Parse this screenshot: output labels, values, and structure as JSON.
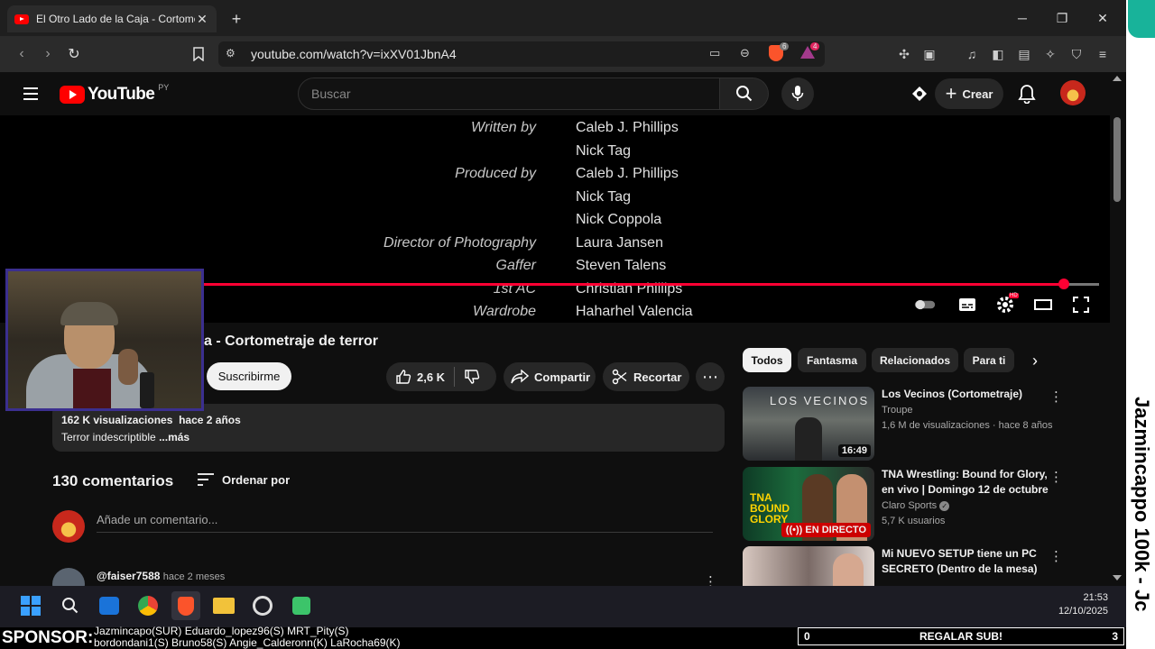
{
  "browser": {
    "tab_title": "El Otro Lado de la Caja - Cortometraje de terror",
    "url": "youtube.com/watch?v=ixXV01JbnA4",
    "extension_badges": [
      "6",
      "4"
    ]
  },
  "youtube": {
    "logo_text": "YouTube",
    "country_code": "PY",
    "search_placeholder": "Buscar",
    "create_label": "Crear"
  },
  "video": {
    "credits": [
      {
        "role": "Written by",
        "name": "Caleb J. Phillips"
      },
      {
        "role": "",
        "name": "Nick Tag"
      },
      {
        "role": "Produced by",
        "name": "Caleb J. Phillips"
      },
      {
        "role": "",
        "name": "Nick Tag"
      },
      {
        "role": "",
        "name": "Nick Coppola"
      },
      {
        "role": "Director of Photography",
        "name": "Laura Jansen"
      },
      {
        "role": "Gaffer",
        "name": "Steven Talens"
      },
      {
        "role": "1st AC",
        "name": "Christian Phillips"
      },
      {
        "role": "Wardrobe",
        "name": "Haharhel Valencia"
      }
    ],
    "progress": 0.96,
    "title_visible": "a - Cortometraje de terror",
    "subscribe_label": "Suscribirme",
    "likes": "2,6 K",
    "share_label": "Compartir",
    "clip_label": "Recortar",
    "views": "162 K visualizaciones",
    "age": "hace 2 años",
    "description": "Terror indescriptible",
    "more_label": "...más"
  },
  "comments": {
    "count_label": "130 comentarios",
    "sort_label": "Ordenar por",
    "add_placeholder": "Añade un comentario...",
    "first": {
      "user": "@faiser7588",
      "when": "hace 2 meses"
    }
  },
  "chips": [
    "Todos",
    "Fantasma",
    "Relacionados",
    "Para ti"
  ],
  "recommendations": [
    {
      "title": "Los Vecinos (Cortometraje)",
      "channel": "Troupe",
      "meta": "1,6 M de visualizaciones · hace 8 años",
      "duration": "16:49",
      "thumb_text": "LOS VECINOS"
    },
    {
      "title": "TNA Wrestling: Bound for Glory, en vivo | Domingo 12 de octubre",
      "channel": "Claro Sports",
      "meta": "5,7 K usuarios",
      "badge": "EN DIRECTO"
    },
    {
      "title": "Mi NUEVO SETUP tiene un PC SECRETO (Dentro de la mesa)",
      "channel": "",
      "meta": ""
    }
  ],
  "taskbar": {
    "time": "21:53",
    "date": "12/10/2025"
  },
  "stream": {
    "sponsor_label": "SPONSOR:",
    "sponsor_line1": "Jazmincapo(SUR) Eduardo_lopez96(S) MRT_Pity(S)",
    "sponsor_line2": "bordondani1(S) Bruno58(S) Angie_Calderonn(K) LaRocha69(K)",
    "goal_left": "0",
    "goal_label": "REGALAR SUB!",
    "goal_right": "3",
    "side_text": "Jazmincappo 100k - Jc"
  },
  "colors": {
    "youtube_red": "#ff0000",
    "progress_red": "#ff0033",
    "bg": "#0f0f0f",
    "chip_bg": "#272727"
  }
}
